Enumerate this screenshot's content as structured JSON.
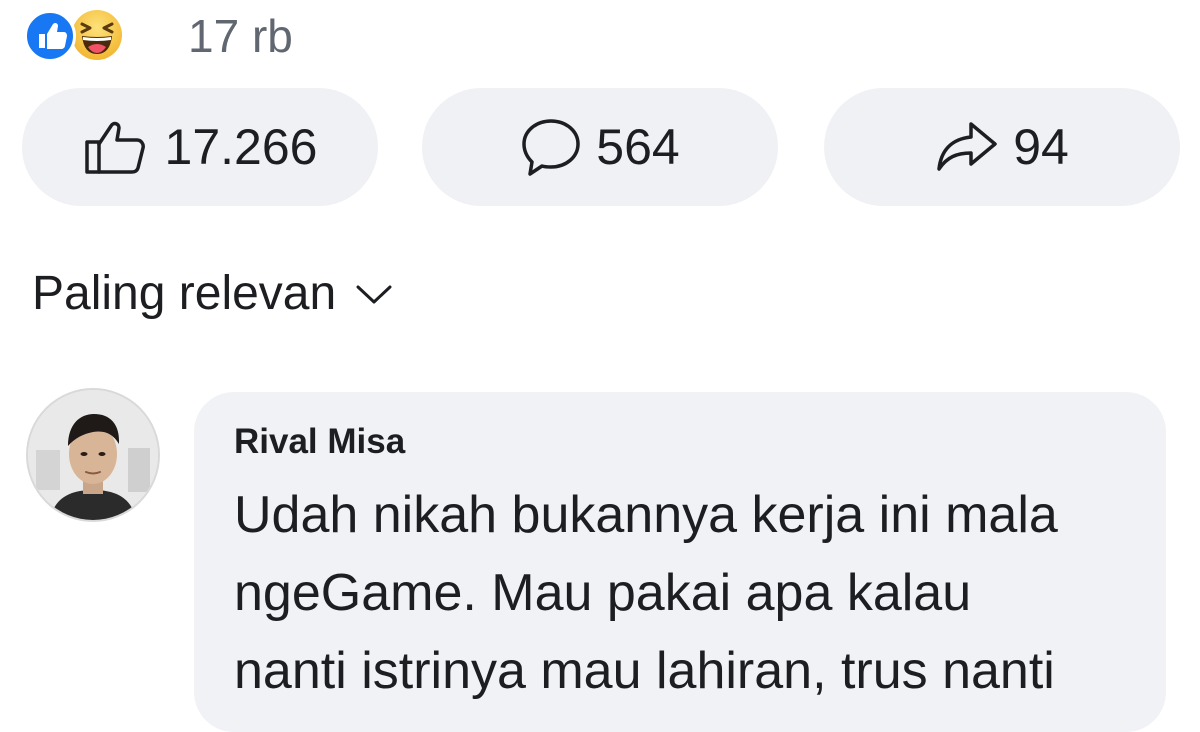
{
  "reactions": {
    "count": "17 rb",
    "types": [
      "like-icon",
      "haha-icon"
    ]
  },
  "actions": {
    "like": {
      "icon": "thumbs-up-icon",
      "count": "17.266"
    },
    "comment": {
      "icon": "comment-bubble-icon",
      "count": "564"
    },
    "share": {
      "icon": "share-arrow-icon",
      "count": "94"
    }
  },
  "sort": {
    "label": "Paling relevan",
    "icon": "chevron-down-icon"
  },
  "comment": {
    "author": "Rival Misa",
    "lines": [
      "Udah nikah bukannya kerja ini mala",
      "ngeGame. Mau pakai apa kalau",
      "nanti istrinya mau lahiran, trus nanti"
    ]
  },
  "colors": {
    "like_blue": "#1877f2",
    "haha_yellow": "#f7c947",
    "pill_bg": "#eff1f5",
    "bubble_bg": "#f0f2f5",
    "secondary_text": "#606770"
  }
}
